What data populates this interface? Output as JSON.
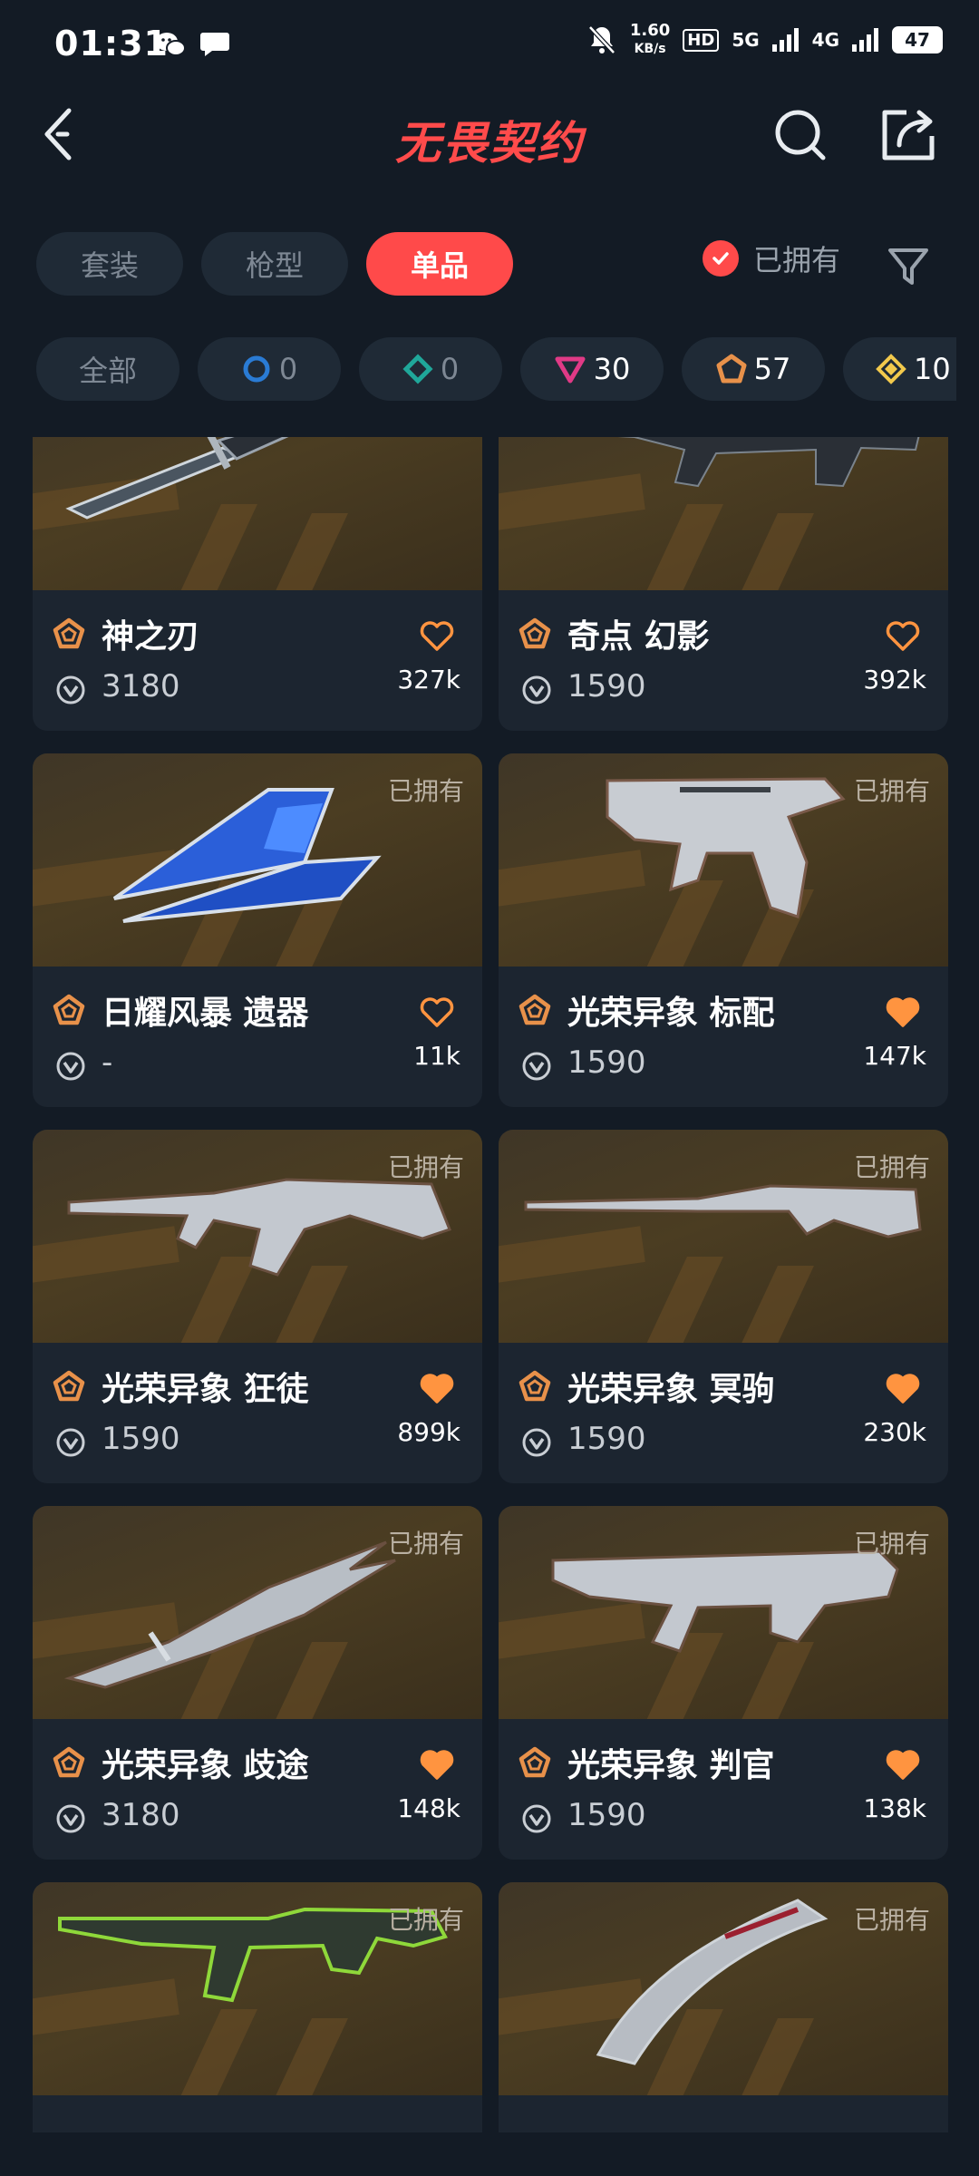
{
  "status_bar": {
    "time": "01:31",
    "speed_value": "1.60",
    "speed_unit": "KB/s",
    "hd": "HD",
    "net1": "5G",
    "net2": "4G",
    "battery": "47"
  },
  "header": {
    "title": "无畏契约"
  },
  "tabs": [
    {
      "label": "套装",
      "active": false
    },
    {
      "label": "枪型",
      "active": false
    },
    {
      "label": "单品",
      "active": true
    }
  ],
  "owned_filter": {
    "label": "已拥有",
    "checked": true
  },
  "chips": [
    {
      "label": "全部"
    },
    {
      "count": "0",
      "icon": "select-tier-icon",
      "color": "#2a7bd4"
    },
    {
      "count": "0",
      "icon": "deluxe-tier-icon",
      "color": "#1fa79a"
    },
    {
      "count": "30",
      "icon": "premium-tier-icon",
      "color": "#e03a86"
    },
    {
      "count": "57",
      "icon": "exclusive-tier-icon",
      "color": "#e8914a"
    },
    {
      "count": "10",
      "icon": "ultra-tier-icon",
      "color": "#f2c94c"
    }
  ],
  "owned_tag": "已拥有",
  "items": [
    {
      "name": "神之刃",
      "price": "3180",
      "likes": "327k",
      "liked": false,
      "weapon": "knife"
    },
    {
      "name": "奇点 幻影",
      "price": "1590",
      "likes": "392k",
      "liked": false,
      "weapon": "rifle-dark"
    },
    {
      "name": "日耀风暴 遗器",
      "price": "-",
      "likes": "11k",
      "liked": false,
      "weapon": "crystal"
    },
    {
      "name": "光荣异象 标配",
      "price": "1590",
      "likes": "147k",
      "liked": true,
      "weapon": "pistol"
    },
    {
      "name": "光荣异象 狂徒",
      "price": "1590",
      "likes": "899k",
      "liked": true,
      "weapon": "rifle"
    },
    {
      "name": "光荣异象 冥驹",
      "price": "1590",
      "likes": "230k",
      "liked": true,
      "weapon": "sniper"
    },
    {
      "name": "光荣异象 歧途",
      "price": "3180",
      "likes": "148k",
      "liked": true,
      "weapon": "blade"
    },
    {
      "name": "光荣异象 判官",
      "price": "1590",
      "likes": "138k",
      "liked": true,
      "weapon": "shotgun"
    },
    {
      "name": "",
      "price": "",
      "likes": "",
      "liked": false,
      "weapon": "green-rifle"
    },
    {
      "name": "",
      "price": "",
      "likes": "",
      "liked": false,
      "weapon": "karambit"
    }
  ],
  "colors": {
    "accent": "#ff4a4a",
    "exclusive": "#e8914a",
    "heart": "#ff9440",
    "background": "#131b25"
  }
}
